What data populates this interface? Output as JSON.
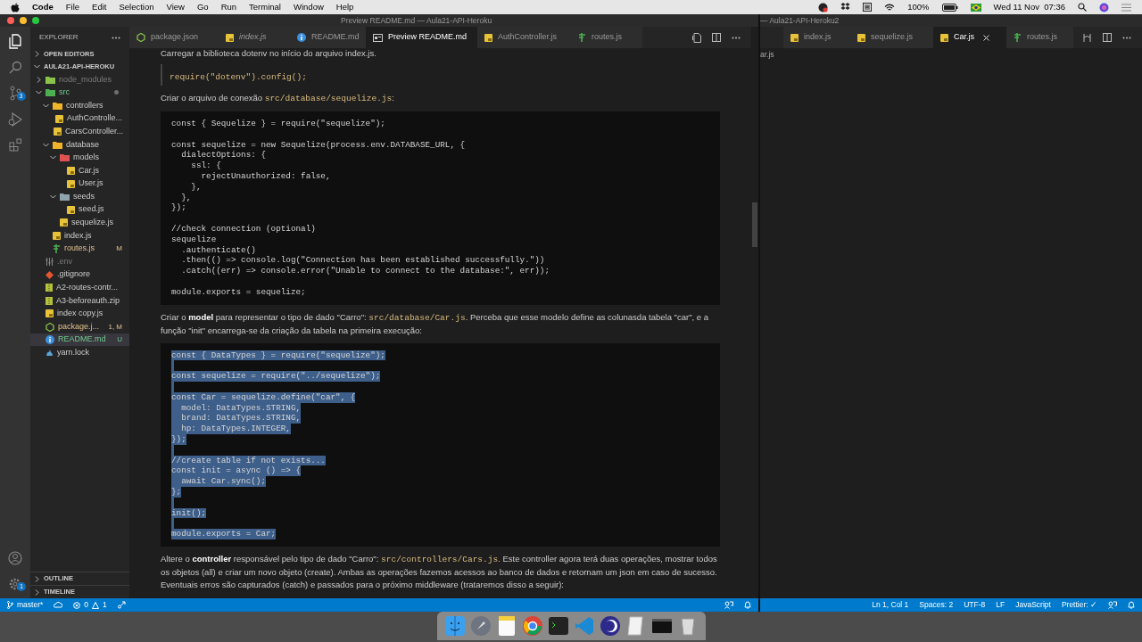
{
  "menubar": {
    "app": "Code",
    "menus": [
      "File",
      "Edit",
      "Selection",
      "View",
      "Go",
      "Run",
      "Terminal",
      "Window",
      "Help"
    ],
    "battery": "100%",
    "clock": "Wed 11 Nov  07:36"
  },
  "left_window": {
    "title": "Preview README.md — Aula21-API-Heroku",
    "activity_bar": {
      "source_control_badge": "3",
      "settings_badge": "1"
    },
    "explorer": {
      "title": "EXPLORER",
      "open_editors": "OPEN EDITORS",
      "project": "AULA21-API-HEROKU",
      "tree": [
        {
          "label": "node_modules",
          "kind": "nodefolder",
          "ignored": true,
          "untracked": false,
          "modified": false,
          "expanded": false,
          "dot": false,
          "selected": false
        },
        {
          "label": "src",
          "kind": "srcfolder",
          "ignored": false,
          "untracked": true,
          "modified": false,
          "expanded": true,
          "dot": true,
          "selected": false,
          "children": [
            {
              "label": "controllers",
              "kind": "folder",
              "ignored": false,
              "untracked": false,
              "modified": false,
              "expanded": true,
              "dot": false,
              "selected": false,
              "children": [
                {
                  "label": "AuthControlle...",
                  "kind": "js",
                  "ignored": false,
                  "untracked": false,
                  "modified": false,
                  "selected": false
                },
                {
                  "label": "CarsController...",
                  "kind": "js",
                  "ignored": false,
                  "untracked": false,
                  "modified": false,
                  "selected": false
                }
              ]
            },
            {
              "label": "database",
              "kind": "folder",
              "ignored": false,
              "untracked": false,
              "modified": false,
              "expanded": true,
              "dot": false,
              "selected": false,
              "children": [
                {
                  "label": "models",
                  "kind": "modelfolder",
                  "ignored": false,
                  "untracked": false,
                  "modified": false,
                  "expanded": true,
                  "dot": false,
                  "selected": false,
                  "children": [
                    {
                      "label": "Car.js",
                      "kind": "js",
                      "ignored": false,
                      "untracked": false,
                      "modified": false,
                      "selected": false
                    },
                    {
                      "label": "User.js",
                      "kind": "js",
                      "ignored": false,
                      "untracked": false,
                      "modified": false,
                      "selected": false
                    }
                  ]
                },
                {
                  "label": "seeds",
                  "kind": "seedfolder",
                  "ignored": false,
                  "untracked": false,
                  "modified": false,
                  "expanded": true,
                  "dot": false,
                  "selected": false,
                  "children": [
                    {
                      "label": "seed.js",
                      "kind": "js",
                      "ignored": false,
                      "untracked": false,
                      "modified": false,
                      "selected": false
                    }
                  ]
                },
                {
                  "label": "sequelize.js",
                  "kind": "js",
                  "ignored": false,
                  "untracked": false,
                  "modified": false,
                  "selected": false
                }
              ]
            },
            {
              "label": "index.js",
              "kind": "js",
              "ignored": false,
              "untracked": false,
              "modified": false,
              "selected": false
            },
            {
              "label": "routes.js",
              "kind": "routes",
              "ignored": false,
              "untracked": false,
              "modified": true,
              "badge": "M",
              "selected": false
            }
          ]
        },
        {
          "label": ".env",
          "kind": "env",
          "ignored": true,
          "untracked": false,
          "modified": false,
          "selected": false
        },
        {
          "label": ".gitignore",
          "kind": "git",
          "ignored": false,
          "untracked": false,
          "modified": false,
          "selected": false
        },
        {
          "label": "A2-routes-contr...",
          "kind": "zip",
          "ignored": false,
          "untracked": false,
          "modified": false,
          "selected": false
        },
        {
          "label": "A3-beforeauth.zip",
          "kind": "zip",
          "ignored": false,
          "untracked": false,
          "modified": false,
          "selected": false
        },
        {
          "label": "index copy.js",
          "kind": "js",
          "ignored": false,
          "untracked": false,
          "modified": false,
          "selected": false
        },
        {
          "label": "package.j...",
          "kind": "json",
          "ignored": false,
          "untracked": false,
          "modified": true,
          "badge": "1, M",
          "selected": false
        },
        {
          "label": "README.md",
          "kind": "info",
          "ignored": false,
          "untracked": true,
          "modified": false,
          "badge": "U",
          "selected": true
        },
        {
          "label": "yarn.lock",
          "kind": "yarn",
          "ignored": false,
          "untracked": false,
          "modified": false,
          "selected": false
        }
      ],
      "outline": "OUTLINE",
      "timeline": "TIMELINE"
    },
    "tabs": [
      {
        "label": "package.json",
        "kind": "json",
        "preview": false,
        "selected": false
      },
      {
        "label": "index.js",
        "kind": "js",
        "preview": true,
        "selected": false
      },
      {
        "label": "README.md",
        "kind": "info",
        "preview": false,
        "selected": false
      },
      {
        "label": "Preview README.md",
        "kind": "preview",
        "preview": false,
        "selected": true
      },
      {
        "label": "AuthController.js",
        "kind": "js",
        "preview": false,
        "selected": false
      },
      {
        "label": "routes.js",
        "kind": "routes",
        "preview": false,
        "selected": false
      }
    ],
    "preview_blocks": [
      {
        "kind": "cut",
        "text": "Carregar a biblioteca dotenv no início do arquivo index.js."
      },
      {
        "kind": "quote",
        "text": "require(\"dotenv\").config();"
      },
      {
        "kind": "paragraph",
        "segments": [
          {
            "kind": "text",
            "text": "Criar o arquivo de conexão "
          },
          {
            "kind": "code",
            "text": "src/database/sequelize.js"
          },
          {
            "kind": "text",
            "text": ":"
          }
        ]
      },
      {
        "kind": "code",
        "selected": false,
        "groups": [
          [
            "const { Sequelize } = require(\"sequelize\");"
          ],
          [
            "const sequelize = new Sequelize(process.env.DATABASE_URL, {",
            "  dialectOptions: {",
            "    ssl: {",
            "      rejectUnauthorized: false,",
            "    },",
            "  },",
            "});"
          ],
          [
            "//check connection (optional)",
            "sequelize",
            "  .authenticate()",
            "  .then(() => console.log(\"Connection has been established successfully.\"))",
            "  .catch((err) => console.error(\"Unable to connect to the database:\", err));"
          ],
          [
            "module.exports = sequelize;"
          ]
        ]
      },
      {
        "kind": "paragraph",
        "segments": [
          {
            "kind": "text",
            "text": "Criar o "
          },
          {
            "kind": "bold",
            "text": "model"
          },
          {
            "kind": "text",
            "text": " para representar o tipo de dado \"Carro\": "
          },
          {
            "kind": "code",
            "text": "src/database/Car.js"
          },
          {
            "kind": "text",
            "text": ". Perceba que esse modelo define as colunasda tabela \"car\", e a função \"init\" encarrega-se da criação da tabela na primeira execução:"
          }
        ]
      },
      {
        "kind": "code",
        "selected": true,
        "groups": [
          [
            "const { DataTypes } = require(\"sequelize\");"
          ],
          [
            "const sequelize = require(\"../sequelize\");"
          ],
          [
            "const Car = sequelize.define(\"car\", {",
            "  model: DataTypes.STRING,",
            "  brand: DataTypes.STRING,",
            "  hp: DataTypes.INTEGER,",
            "});"
          ],
          [
            "//create table if not exists...",
            "const init = async () => {",
            "  await Car.sync();",
            "};"
          ],
          [
            "init();"
          ],
          [
            "module.exports = Car;"
          ]
        ]
      },
      {
        "kind": "paragraph",
        "segments": [
          {
            "kind": "text",
            "text": "Altere o "
          },
          {
            "kind": "bold",
            "text": "controller"
          },
          {
            "kind": "text",
            "text": " responsável pelo tipo de dado \"Carro\": "
          },
          {
            "kind": "code",
            "text": "src/controllers/Cars.js"
          },
          {
            "kind": "text",
            "text": ". Este controller agora terá duas operações, mostrar todos os objetos (all) e criar um novo objeto (create). Ambas as operações fazemos acessos ao banco de dados e retornam um json em caso de sucesso. Eventuais erros são capturados (catch) e passados para o próximo middleware (trataremos disso a seguir):"
          }
        ]
      }
    ],
    "status_bar": {
      "branch": "master*",
      "errors": "0",
      "warnings": "1"
    }
  },
  "right_window": {
    "title": "— Aula21-API-Heroku2",
    "breadcrumb": "ar.js",
    "tabs": [
      {
        "label": "index.js",
        "kind": "js",
        "selected": false
      },
      {
        "label": "sequelize.js",
        "kind": "js",
        "selected": false
      },
      {
        "label": "Car.js",
        "kind": "js",
        "selected": true
      },
      {
        "label": "routes.js",
        "kind": "routes",
        "selected": false
      }
    ],
    "status_bar": [
      "Ln 1, Col 1",
      "Spaces: 2",
      "UTF-8",
      "LF",
      "JavaScript",
      "Prettier: ✓"
    ]
  }
}
